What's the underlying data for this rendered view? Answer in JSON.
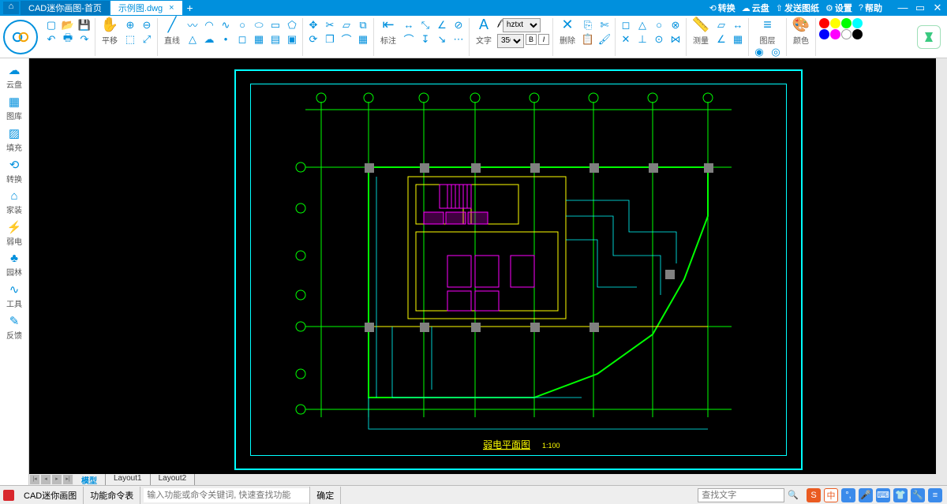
{
  "titlebar": {
    "tab_home": "CAD迷你画图-首页",
    "tab_active": "示例图.dwg",
    "menu_convert": "转换",
    "menu_cloud": "云盘",
    "menu_send": "发送图纸",
    "menu_settings": "设置",
    "menu_help": "帮助"
  },
  "toolbar": {
    "pan": "平移",
    "line": "直线",
    "annotate": "标注",
    "text": "文字",
    "font_value": "hztxt",
    "size_value": "350",
    "bold": "B",
    "italic": "I",
    "delete": "删除",
    "measure": "测量",
    "layer": "图层",
    "color": "颜色"
  },
  "sidebar": {
    "items": [
      {
        "icon": "☁",
        "label": "云盘"
      },
      {
        "icon": "▦",
        "label": "图库"
      },
      {
        "icon": "▨",
        "label": "填充"
      },
      {
        "icon": "⟲",
        "label": "转换"
      },
      {
        "icon": "⌂",
        "label": "家装"
      },
      {
        "icon": "⚡",
        "label": "弱电"
      },
      {
        "icon": "♣",
        "label": "园林"
      },
      {
        "icon": "∿",
        "label": "工具"
      },
      {
        "icon": "✎",
        "label": "反馈"
      }
    ]
  },
  "layouts": {
    "model": "模型",
    "l1": "Layout1",
    "l2": "Layout2"
  },
  "drawing": {
    "title": "弱电平面图",
    "scale": "1:100"
  },
  "status": {
    "app_name": "CAD迷你画图",
    "func_table": "功能命令表",
    "cmd_placeholder": "输入功能或命令关键词, 快速查找功能",
    "ok": "确定",
    "search_placeholder": "查找文字",
    "ime": "中"
  },
  "swatches": [
    "#ff0000",
    "#ffff00",
    "#00ff00",
    "#00ffff",
    "#0000ff",
    "#ff00ff",
    "#ffffff",
    "#000000"
  ]
}
